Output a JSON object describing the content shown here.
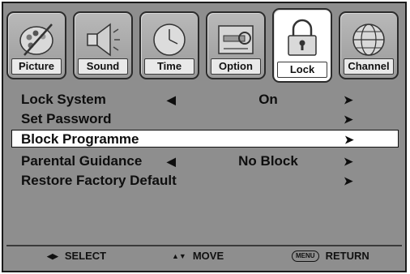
{
  "tabs": [
    {
      "label": "Picture",
      "icon": "picture-icon",
      "active": false
    },
    {
      "label": "Sound",
      "icon": "speaker-icon",
      "active": false
    },
    {
      "label": "Time",
      "icon": "clock-icon",
      "active": false
    },
    {
      "label": "Option",
      "icon": "wrench-icon",
      "active": false
    },
    {
      "label": "Lock",
      "icon": "padlock-icon",
      "active": true
    },
    {
      "label": "Channel",
      "icon": "globe-icon",
      "active": false
    }
  ],
  "menu": {
    "rows": [
      {
        "label": "Lock System",
        "value": "On",
        "left_arrow": "◀",
        "right_arrow": "➤"
      },
      {
        "label": "Set Password",
        "value": "",
        "right_arrow": "➤"
      },
      {
        "label": "Block Programme",
        "value": "",
        "right_arrow": "➤",
        "selected": true
      },
      {
        "label": "Parental Guidance",
        "value": "No Block",
        "left_arrow": "◀",
        "right_arrow": "➤"
      },
      {
        "label": "Restore Factory Default",
        "value": "",
        "right_arrow": "➤"
      }
    ]
  },
  "footer": {
    "select_label": "SELECT",
    "move_label": "MOVE",
    "menu_key": "MENU",
    "return_label": "RETURN",
    "select_keys": "◀▶",
    "move_keys": "▲▼"
  },
  "colors": {
    "panel": "#8e8e8e",
    "selected_row": "#ffffff",
    "text": "#0e0e0e"
  }
}
